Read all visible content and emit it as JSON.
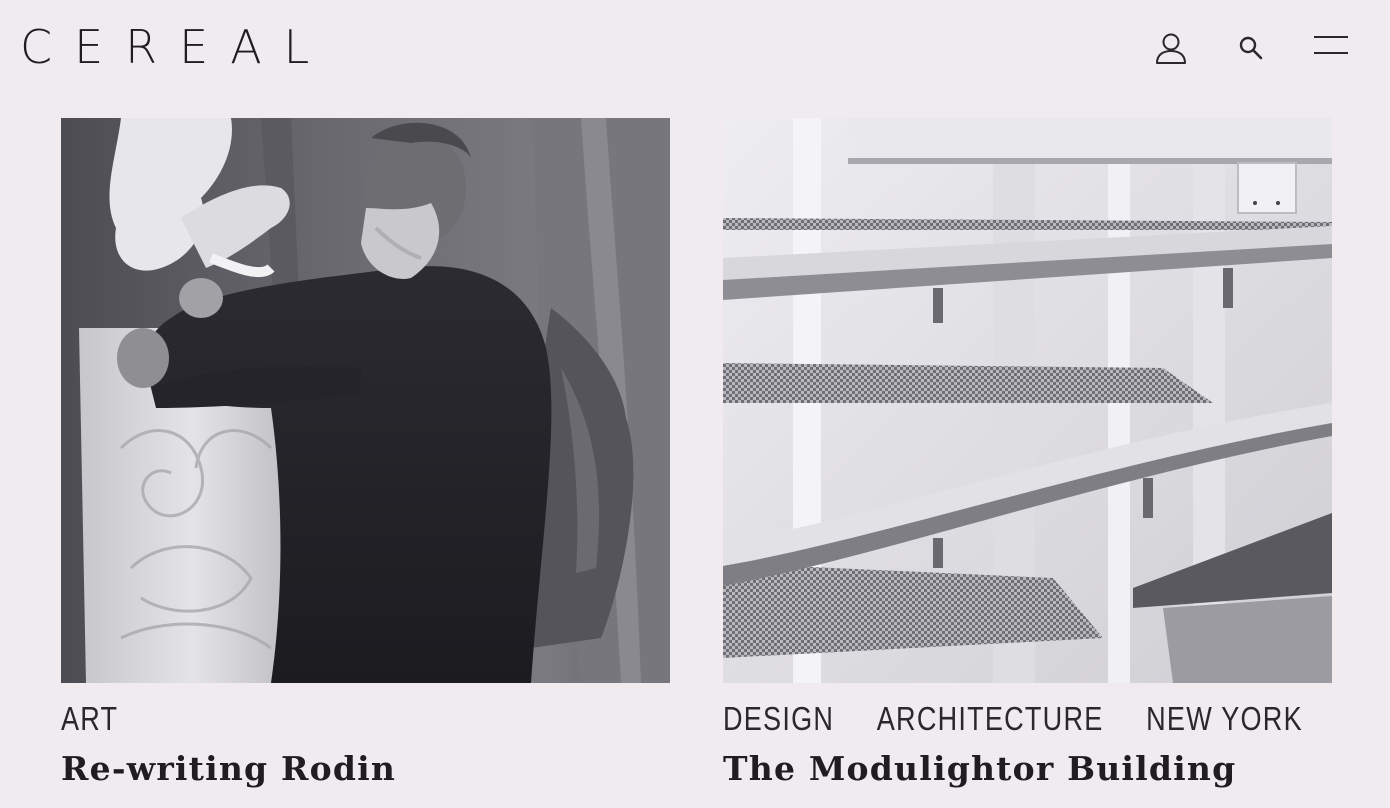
{
  "header": {
    "logo": "CEREAL",
    "icons": [
      "account-icon",
      "search-icon",
      "menu-icon"
    ]
  },
  "articles": [
    {
      "tags": [
        "ART"
      ],
      "title": "Re-writing Rodin",
      "image": "sculptor-photo"
    },
    {
      "tags": [
        "DESIGN",
        "ARCHITECTURE",
        "NEW YORK"
      ],
      "title": "The Modulightor Building",
      "image": "shelving-photo"
    }
  ],
  "colors": {
    "background": "#efebee",
    "text": "#1f1d22",
    "separator": "#9b979c"
  }
}
